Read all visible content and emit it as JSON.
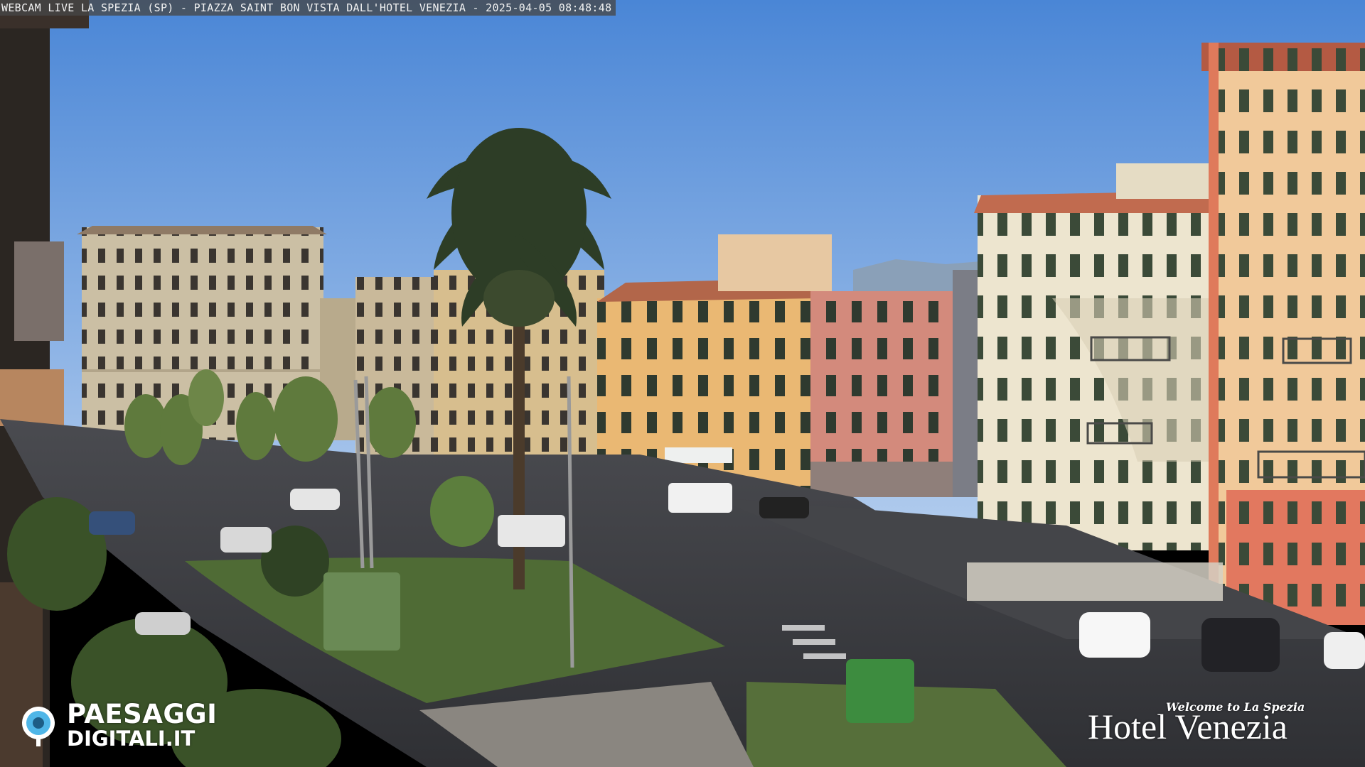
{
  "overlay": {
    "caption": "WEBCAM LIVE LA SPEZIA (SP) - PIAZZA SAINT BON VISTA DALL'HOTEL VENEZIA - 2025-04-05 08:48:48"
  },
  "watermark_left": {
    "line1": "PAESAGGI",
    "line2": "DIGITALI.IT",
    "icon": "camera-lens-icon",
    "accent_color": "#4fb6e8"
  },
  "watermark_right": {
    "tagline": "Welcome to La Spezia",
    "name": "Hotel Venezia"
  },
  "colors": {
    "sky_top": "#4a86d6",
    "sky_bottom": "#a9c8ee",
    "lawn": "#4f6b35",
    "road": "#3e3f43"
  }
}
